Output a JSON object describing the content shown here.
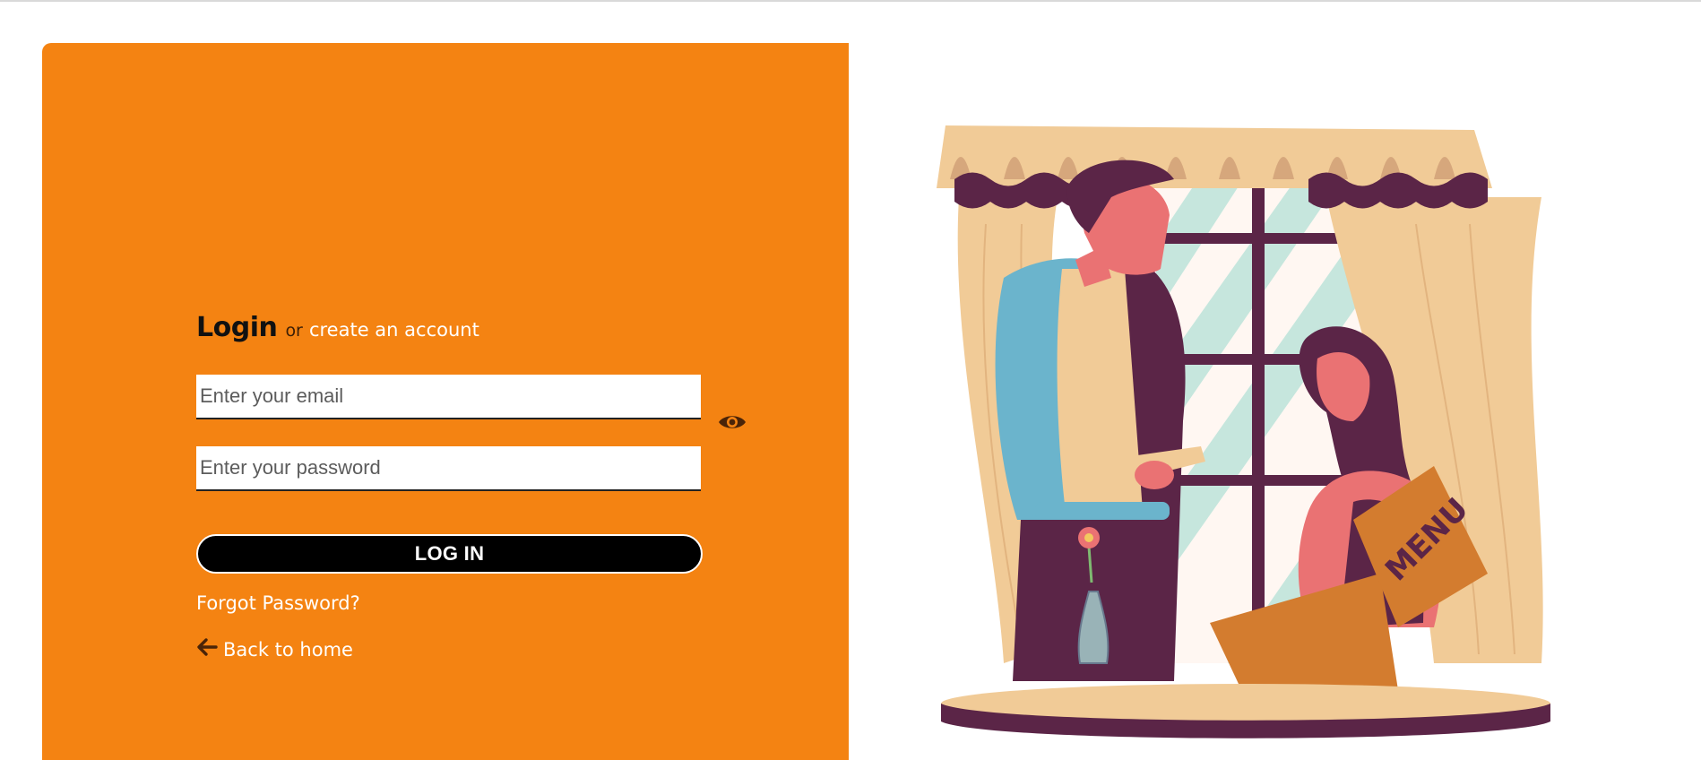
{
  "login": {
    "title": "Login",
    "or_text": "or",
    "create_account_link": "create an account",
    "email_placeholder": "Enter your email",
    "password_placeholder": "Enter your password",
    "submit_label": "LOG IN",
    "forgot_password_link": "Forgot Password?",
    "back_home_link": "Back to home"
  },
  "icons": {
    "password_toggle": "eye-icon",
    "back": "arrow-left-icon"
  },
  "illustration": {
    "menu_text": "MENU"
  },
  "colors": {
    "panel": "#f48312",
    "button": "#000000",
    "text_on_panel": "#ffffff",
    "icon": "#4a2408"
  }
}
